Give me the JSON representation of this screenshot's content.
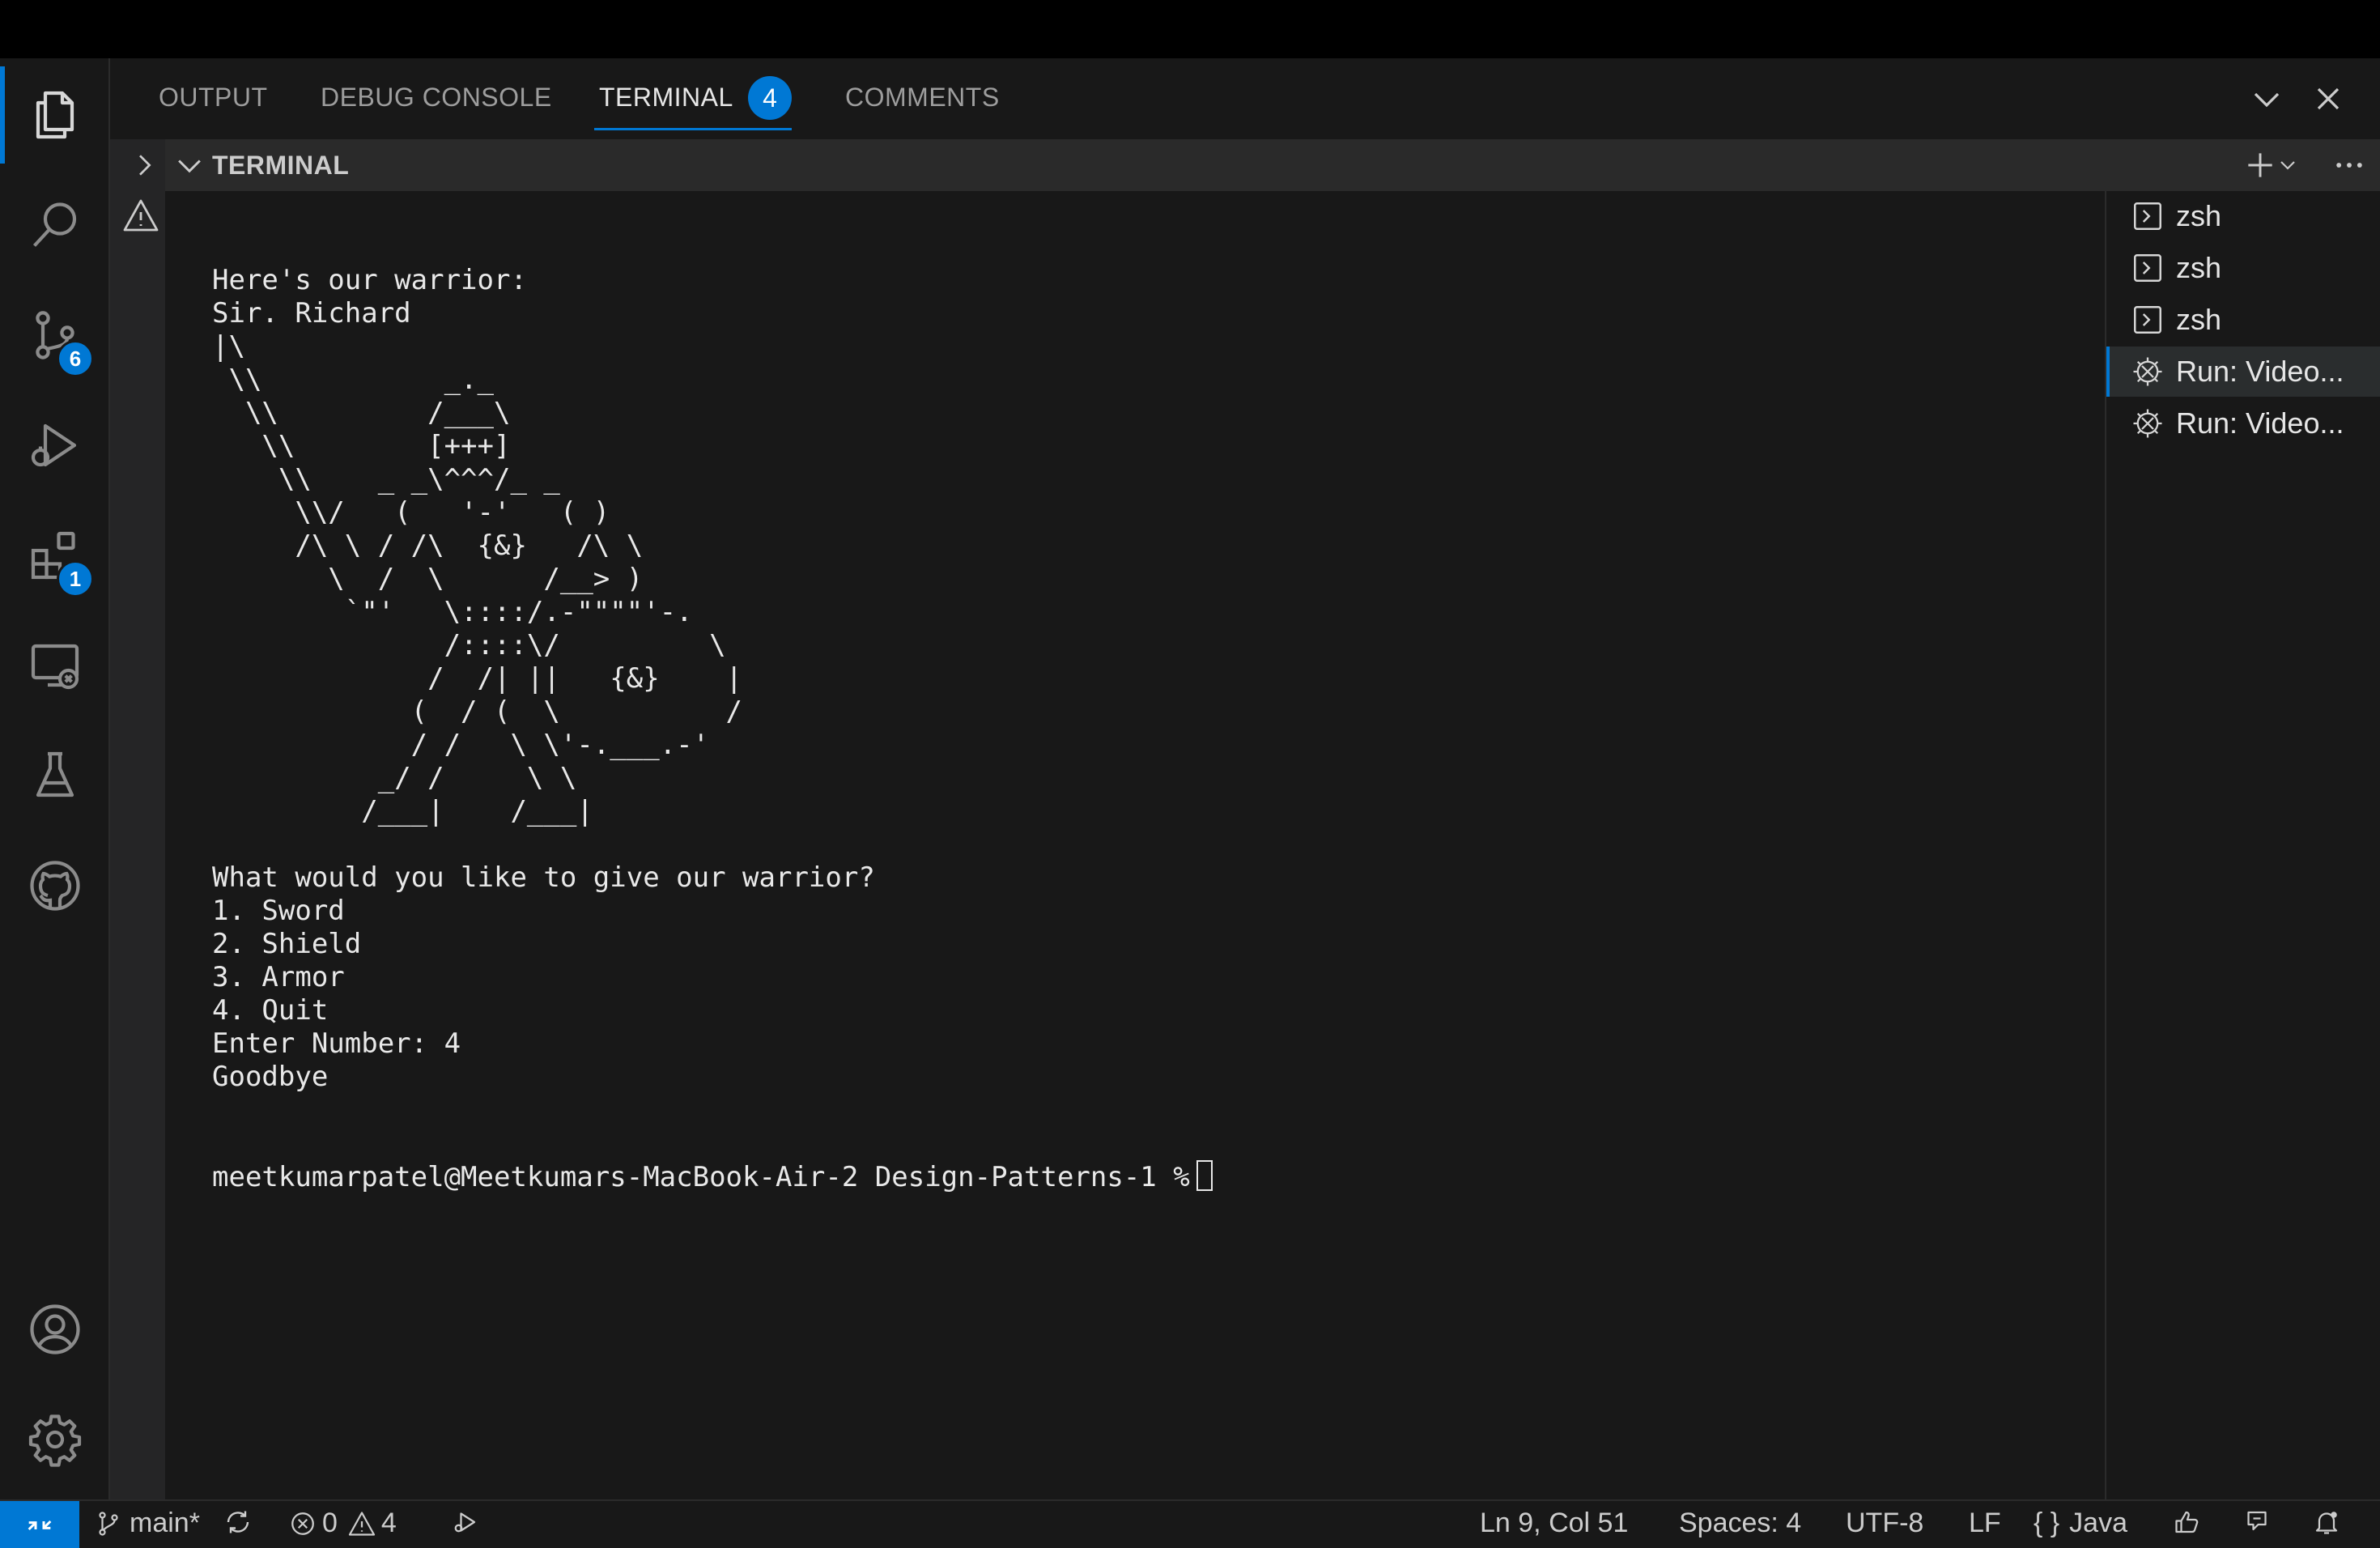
{
  "panel": {
    "tabs": [
      {
        "label": "OUTPUT"
      },
      {
        "label": "DEBUG CONSOLE"
      },
      {
        "label": "TERMINAL",
        "count": "4"
      },
      {
        "label": "COMMENTS"
      }
    ]
  },
  "activity_bar": {
    "source_control_badge": "6",
    "extensions_badge": "1"
  },
  "terminal_section": {
    "title": "TERMINAL"
  },
  "terminal": {
    "lines": [
      "Here's our warrior:",
      "Sir. Richard",
      "|\\",
      " \\\\           _._",
      "  \\\\         /___\\",
      "   \\\\        [+++]",
      "    \\\\    _ _\\^^^/_ _",
      "     \\\\/   (   '-'   ( )",
      "     /\\ \\ / /\\  {&}   /\\ \\",
      "       \\  /  \\      /__> )",
      "        `\"'   \\::::/.-\"\"\"\"'-.",
      "              /::::\\/         \\",
      "             /  /| ||   {&}    |",
      "            (  / (  \\          /",
      "            / /   \\ \\'-.___.-'",
      "          _/ /     \\ \\",
      "         /___|    /___|",
      "",
      "What would you like to give our warrior?",
      "1. Sword",
      "2. Shield",
      "3. Armor",
      "4. Quit",
      "Enter Number: 4",
      "Goodbye"
    ],
    "prompt": "meetkumarpatel@Meetkumars-MacBook-Air-2 Design-Patterns-1 %"
  },
  "terminal_list": [
    {
      "label": "zsh",
      "icon": "terminal-icon"
    },
    {
      "label": "zsh",
      "icon": "terminal-icon"
    },
    {
      "label": "zsh",
      "icon": "terminal-icon"
    },
    {
      "label": "Run: Video...",
      "icon": "debug-icon"
    },
    {
      "label": "Run: Video...",
      "icon": "debug-icon"
    }
  ],
  "statusbar": {
    "branch": "main*",
    "errors": "0",
    "warnings": "4",
    "position": "Ln 9, Col 51",
    "spaces": "Spaces: 4",
    "encoding": "UTF-8",
    "eol": "LF",
    "language_glyph": "{ }",
    "language": "Java"
  },
  "colors": {
    "accent": "#0078d4",
    "background": "#181818",
    "section_header": "#2a2a2a"
  }
}
